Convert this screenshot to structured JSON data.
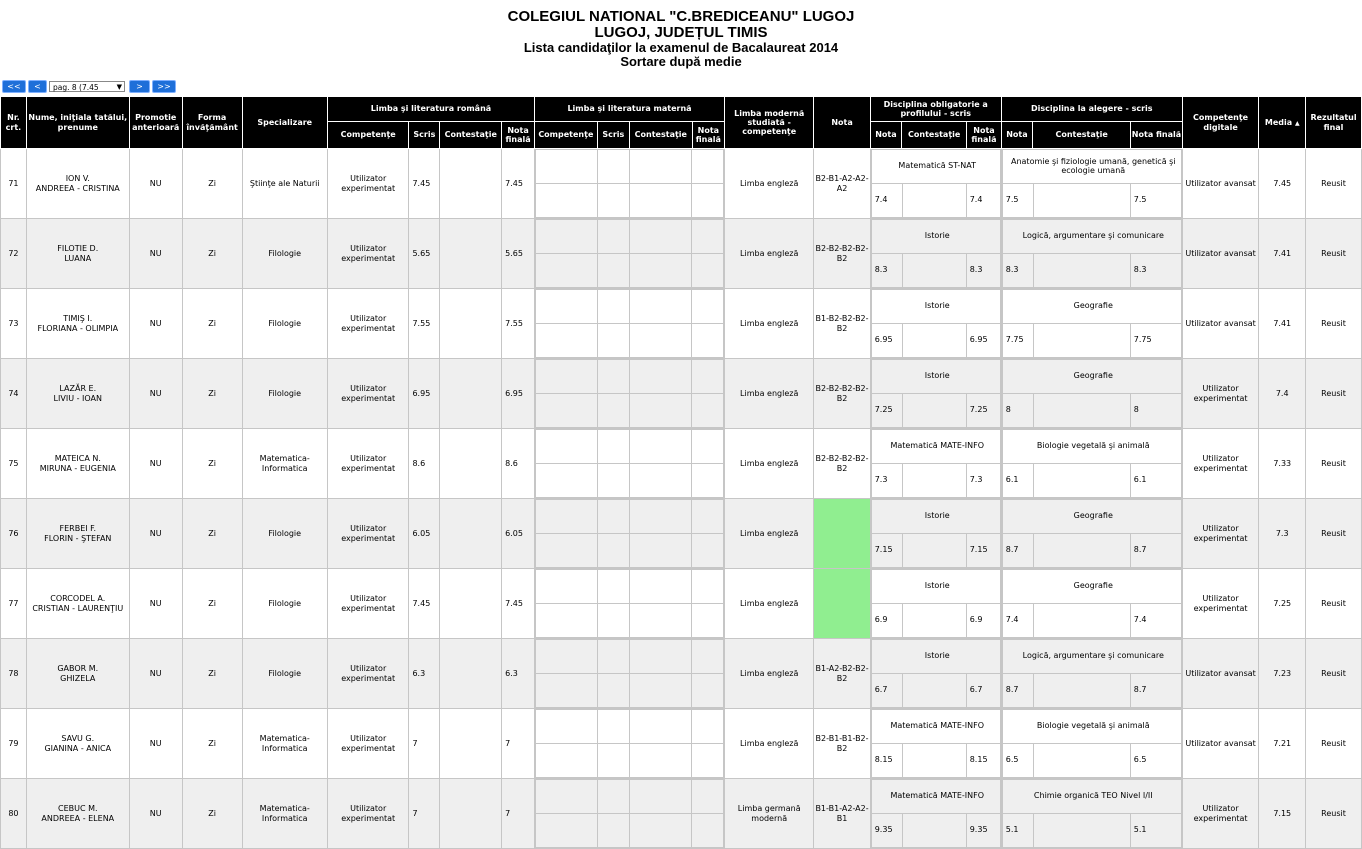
{
  "header": {
    "title1": "COLEGIUL NATIONAL \"C.BREDICEANU\" LUGOJ",
    "title2": "LUGOJ, JUDEȚUL TIMIS",
    "title3": "Lista candidaţilor la examenul de Bacalaureat 2014",
    "title4": "Sortare după medie"
  },
  "pager": {
    "first": "<<",
    "prev": "<",
    "page_select": "pag. 8 (7.45",
    "next": ">",
    "last": ">>"
  },
  "columns": {
    "nr": "Nr. crt.",
    "nume": "Nume, iniţiala tatălui, prenume",
    "promotie": "Promotie anterioară",
    "forma": "Forma învăţământ",
    "specializare": "Specializare",
    "romana": "Limba şi literatura română",
    "materna": "Limba şi literatura maternă",
    "moderna": "Limba modernă studiată - competenţe",
    "nota": "Nota",
    "obligatorie": "Disciplina obligatorie a profilului - scris",
    "alegere": "Disciplina la alegere - scris",
    "digitale": "Competenţe digitale",
    "media": "Media",
    "rezultat": "Rezultatul final",
    "competente": "Competenţe",
    "scris": "Scris",
    "contestatie": "Contestaţie",
    "nota_finala": "Nota finală",
    "nota_sub": "Nota",
    "sort_icon": "▲"
  },
  "rows": [
    {
      "nr": "71",
      "name1": "ION V.",
      "name2": "ANDREEA - CRISTINA",
      "promotie": "NU",
      "forma": "Zi",
      "specializare": "Ştiinţe ale Naturii",
      "ro_comp": "Utilizator experimentat",
      "ro_scris": "7.45",
      "ro_cont": "",
      "ro_final": "7.45",
      "modern_lang": "Limba engleză",
      "modern_nota": "B2-B1-A2-A2-A2",
      "green": false,
      "obl_name": "Matematică ST-NAT",
      "obl_nota": "7.4",
      "obl_cont": "",
      "obl_final": "7.4",
      "ale_name": "Anatomie şi fiziologie umană, genetică şi ecologie umană",
      "ale_nota": "7.5",
      "ale_cont": "",
      "ale_final": "7.5",
      "digitale": "Utilizator avansat",
      "media": "7.45",
      "rezultat": "Reusit"
    },
    {
      "nr": "72",
      "name1": "FILOTIE D.",
      "name2": "LUANA",
      "promotie": "NU",
      "forma": "Zi",
      "specializare": "Filologie",
      "ro_comp": "Utilizator experimentat",
      "ro_scris": "5.65",
      "ro_cont": "",
      "ro_final": "5.65",
      "modern_lang": "Limba engleză",
      "modern_nota": "B2-B2-B2-B2-B2",
      "green": false,
      "obl_name": "Istorie",
      "obl_nota": "8.3",
      "obl_cont": "",
      "obl_final": "8.3",
      "ale_name": "Logică, argumentare şi comunicare",
      "ale_nota": "8.3",
      "ale_cont": "",
      "ale_final": "8.3",
      "digitale": "Utilizator avansat",
      "media": "7.41",
      "rezultat": "Reusit"
    },
    {
      "nr": "73",
      "name1": "TIMIŞ I.",
      "name2": "FLORIANA - OLIMPIA",
      "promotie": "NU",
      "forma": "Zi",
      "specializare": "Filologie",
      "ro_comp": "Utilizator experimentat",
      "ro_scris": "7.55",
      "ro_cont": "",
      "ro_final": "7.55",
      "modern_lang": "Limba engleză",
      "modern_nota": "B1-B2-B2-B2-B2",
      "green": false,
      "obl_name": "Istorie",
      "obl_nota": "6.95",
      "obl_cont": "",
      "obl_final": "6.95",
      "ale_name": "Geografie",
      "ale_nota": "7.75",
      "ale_cont": "",
      "ale_final": "7.75",
      "digitale": "Utilizator avansat",
      "media": "7.41",
      "rezultat": "Reusit"
    },
    {
      "nr": "74",
      "name1": "LAZĂR E.",
      "name2": "LIVIU - IOAN",
      "promotie": "NU",
      "forma": "Zi",
      "specializare": "Filologie",
      "ro_comp": "Utilizator experimentat",
      "ro_scris": "6.95",
      "ro_cont": "",
      "ro_final": "6.95",
      "modern_lang": "Limba engleză",
      "modern_nota": "B2-B2-B2-B2-B2",
      "green": false,
      "obl_name": "Istorie",
      "obl_nota": "7.25",
      "obl_cont": "",
      "obl_final": "7.25",
      "ale_name": "Geografie",
      "ale_nota": "8",
      "ale_cont": "",
      "ale_final": "8",
      "digitale": "Utilizator experimentat",
      "media": "7.4",
      "rezultat": "Reusit"
    },
    {
      "nr": "75",
      "name1": "MATEICA N.",
      "name2": "MIRUNA - EUGENIA",
      "promotie": "NU",
      "forma": "Zi",
      "specializare": "Matematica-Informatica",
      "ro_comp": "Utilizator experimentat",
      "ro_scris": "8.6",
      "ro_cont": "",
      "ro_final": "8.6",
      "modern_lang": "Limba engleză",
      "modern_nota": "B2-B2-B2-B2-B2",
      "green": false,
      "obl_name": "Matematică MATE-INFO",
      "obl_nota": "7.3",
      "obl_cont": "",
      "obl_final": "7.3",
      "ale_name": "Biologie vegetală şi animală",
      "ale_nota": "6.1",
      "ale_cont": "",
      "ale_final": "6.1",
      "digitale": "Utilizator experimentat",
      "media": "7.33",
      "rezultat": "Reusit"
    },
    {
      "nr": "76",
      "name1": "FERBEI F.",
      "name2": "FLORIN - ŞTEFAN",
      "promotie": "NU",
      "forma": "Zi",
      "specializare": "Filologie",
      "ro_comp": "Utilizator experimentat",
      "ro_scris": "6.05",
      "ro_cont": "",
      "ro_final": "6.05",
      "modern_lang": "Limba engleză",
      "modern_nota": "",
      "green": true,
      "obl_name": "Istorie",
      "obl_nota": "7.15",
      "obl_cont": "",
      "obl_final": "7.15",
      "ale_name": "Geografie",
      "ale_nota": "8.7",
      "ale_cont": "",
      "ale_final": "8.7",
      "digitale": "Utilizator experimentat",
      "media": "7.3",
      "rezultat": "Reusit"
    },
    {
      "nr": "77",
      "name1": "CORCODEL A.",
      "name2": "CRISTIAN - LAURENŢIU",
      "promotie": "NU",
      "forma": "Zi",
      "specializare": "Filologie",
      "ro_comp": "Utilizator experimentat",
      "ro_scris": "7.45",
      "ro_cont": "",
      "ro_final": "7.45",
      "modern_lang": "Limba engleză",
      "modern_nota": "",
      "green": true,
      "obl_name": "Istorie",
      "obl_nota": "6.9",
      "obl_cont": "",
      "obl_final": "6.9",
      "ale_name": "Geografie",
      "ale_nota": "7.4",
      "ale_cont": "",
      "ale_final": "7.4",
      "digitale": "Utilizator experimentat",
      "media": "7.25",
      "rezultat": "Reusit"
    },
    {
      "nr": "78",
      "name1": "GABOR M.",
      "name2": "GHIZELA",
      "promotie": "NU",
      "forma": "Zi",
      "specializare": "Filologie",
      "ro_comp": "Utilizator experimentat",
      "ro_scris": "6.3",
      "ro_cont": "",
      "ro_final": "6.3",
      "modern_lang": "Limba engleză",
      "modern_nota": "B1-A2-B2-B2-B2",
      "green": false,
      "obl_name": "Istorie",
      "obl_nota": "6.7",
      "obl_cont": "",
      "obl_final": "6.7",
      "ale_name": "Logică, argumentare şi comunicare",
      "ale_nota": "8.7",
      "ale_cont": "",
      "ale_final": "8.7",
      "digitale": "Utilizator avansat",
      "media": "7.23",
      "rezultat": "Reusit"
    },
    {
      "nr": "79",
      "name1": "SAVU G.",
      "name2": "GIANINA - ANICA",
      "promotie": "NU",
      "forma": "Zi",
      "specializare": "Matematica-Informatica",
      "ro_comp": "Utilizator experimentat",
      "ro_scris": "7",
      "ro_cont": "",
      "ro_final": "7",
      "modern_lang": "Limba engleză",
      "modern_nota": "B2-B1-B1-B2-B2",
      "green": false,
      "obl_name": "Matematică MATE-INFO",
      "obl_nota": "8.15",
      "obl_cont": "",
      "obl_final": "8.15",
      "ale_name": "Biologie vegetală şi animală",
      "ale_nota": "6.5",
      "ale_cont": "",
      "ale_final": "6.5",
      "digitale": "Utilizator avansat",
      "media": "7.21",
      "rezultat": "Reusit"
    },
    {
      "nr": "80",
      "name1": "CEBUC M.",
      "name2": "ANDREEA - ELENA",
      "promotie": "NU",
      "forma": "Zi",
      "specializare": "Matematica-Informatica",
      "ro_comp": "Utilizator experimentat",
      "ro_scris": "7",
      "ro_cont": "",
      "ro_final": "7",
      "modern_lang": "Limba germană modernă",
      "modern_nota": "B1-B1-A2-A2-B1",
      "green": false,
      "obl_name": "Matematică MATE-INFO",
      "obl_nota": "9.35",
      "obl_cont": "",
      "obl_final": "9.35",
      "ale_name": "Chimie organică TEO Nivel I/II",
      "ale_nota": "5.1",
      "ale_cont": "",
      "ale_final": "5.1",
      "digitale": "Utilizator experimentat",
      "media": "7.15",
      "rezultat": "Reusit"
    }
  ]
}
